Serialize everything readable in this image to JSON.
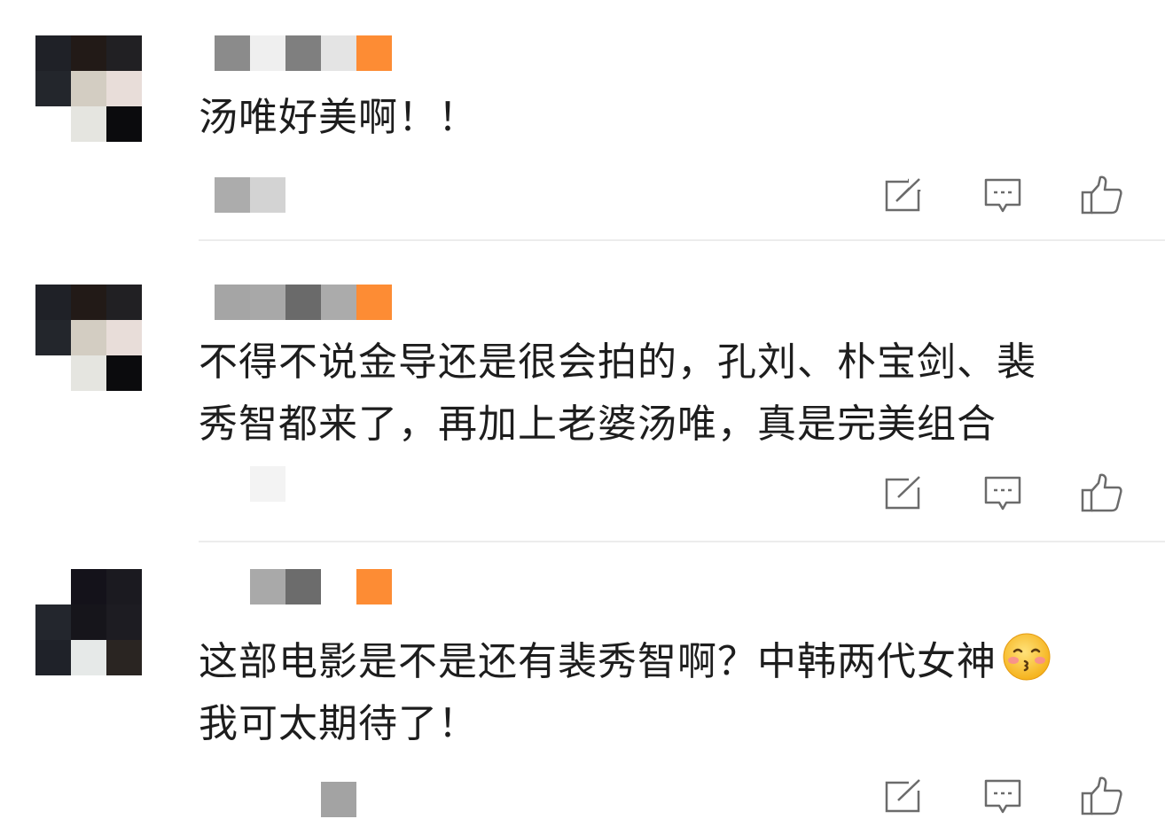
{
  "comments": [
    {
      "text_lines": [
        "汤唯好美啊！！"
      ],
      "actions": {
        "share_icon": "share-icon",
        "reply_icon": "comment-icon",
        "like_icon": "thumbs-up-icon"
      }
    },
    {
      "text_lines": [
        "不得不说金导还是很会拍的，孔刘、朴宝剑、裴",
        "秀智都来了，再加上老婆汤唯，真是完美组合"
      ],
      "actions": {
        "share_icon": "share-icon",
        "reply_icon": "comment-icon",
        "like_icon": "thumbs-up-icon"
      }
    },
    {
      "text_lines": [
        "这部电影是不是还有裴秀智啊？中韩两代女神",
        "我可太期待了！"
      ],
      "emoji": "blushing-kiss-emoji",
      "actions": {
        "share_icon": "share-icon",
        "reply_icon": "comment-icon",
        "like_icon": "thumbs-up-icon"
      }
    }
  ],
  "colors": {
    "text": "#1d1d1d",
    "divider": "#ececec",
    "icon": "#6b6b6b",
    "badge_orange": "#fd8c34"
  }
}
